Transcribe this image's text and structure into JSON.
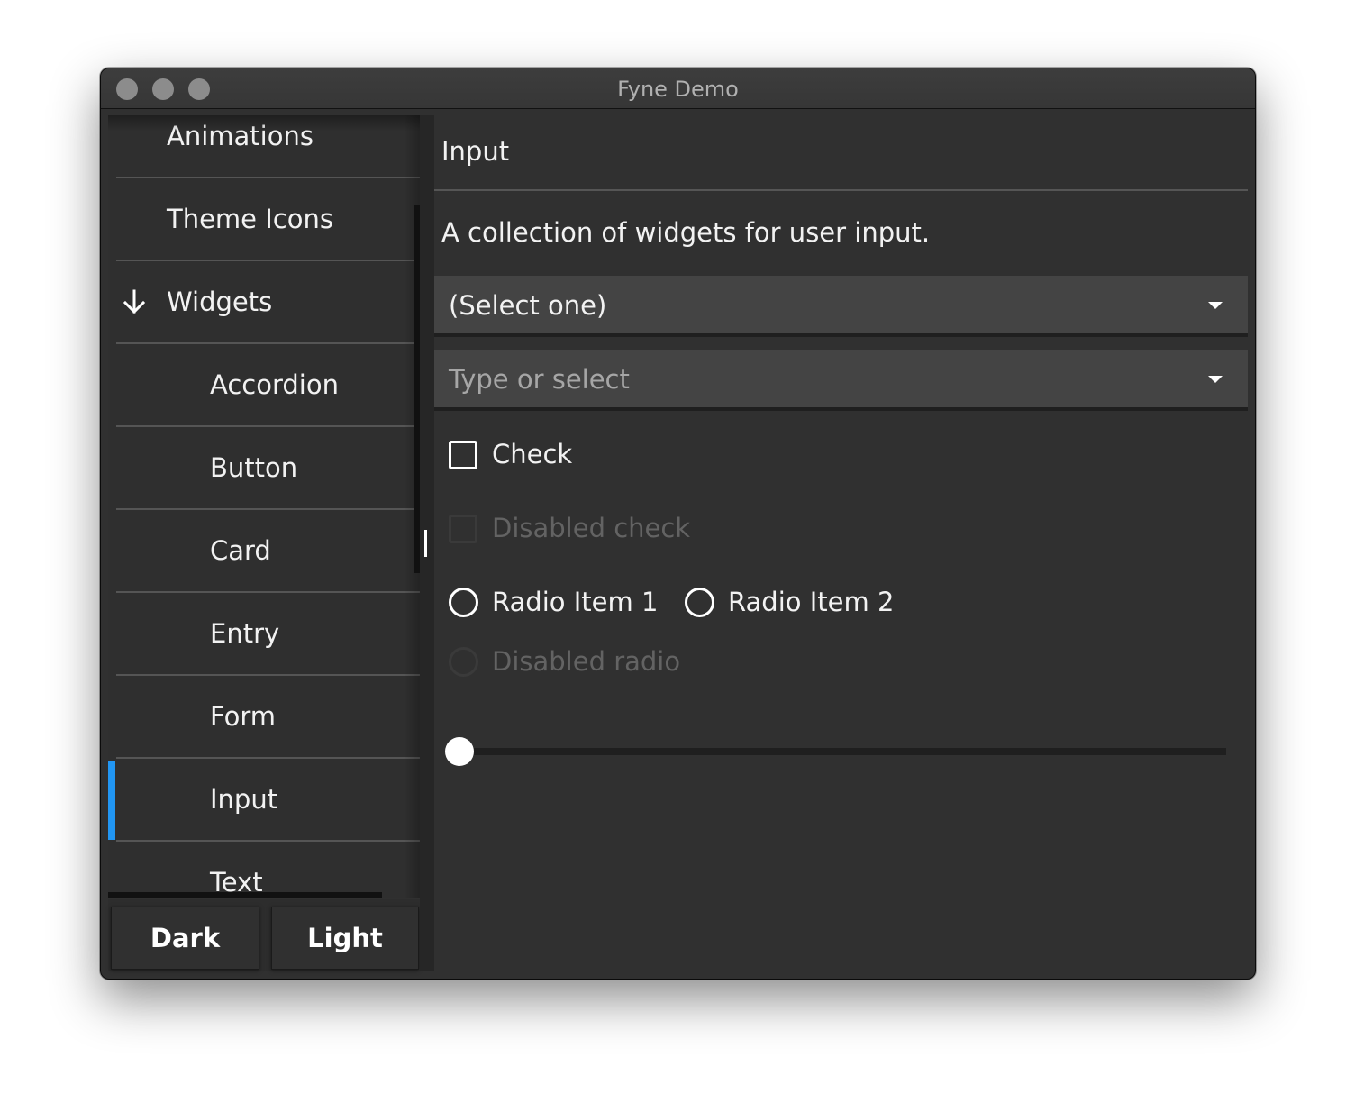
{
  "window": {
    "title": "Fyne Demo",
    "traffic_lights": [
      "close",
      "minimize",
      "zoom"
    ]
  },
  "sidebar": {
    "items": [
      {
        "label": "Animations",
        "level": 0,
        "selected": false
      },
      {
        "label": "Theme Icons",
        "level": 0,
        "selected": false
      },
      {
        "label": "Widgets",
        "level": 0,
        "expanded": true,
        "icon": "arrow-down-icon",
        "selected": false
      },
      {
        "label": "Accordion",
        "level": 1,
        "selected": false
      },
      {
        "label": "Button",
        "level": 1,
        "selected": false
      },
      {
        "label": "Card",
        "level": 1,
        "selected": false
      },
      {
        "label": "Entry",
        "level": 1,
        "selected": false
      },
      {
        "label": "Form",
        "level": 1,
        "selected": false
      },
      {
        "label": "Input",
        "level": 1,
        "selected": true
      },
      {
        "label": "Text",
        "level": 1,
        "selected": false
      }
    ],
    "selection_color": "#2196f3",
    "theme_buttons": {
      "dark": "Dark",
      "light": "Light"
    }
  },
  "content": {
    "title": "Input",
    "description": "A collection of widgets for user input.",
    "select": {
      "value": "(Select one)"
    },
    "select_entry": {
      "placeholder": "Type or select",
      "value": ""
    },
    "check": {
      "label": "Check",
      "checked": false
    },
    "disabled_check": {
      "label": "Disabled check",
      "checked": false
    },
    "radio": {
      "options": [
        "Radio Item 1",
        "Radio Item 2"
      ],
      "selected": null
    },
    "disabled_radio": {
      "label": "Disabled radio"
    },
    "slider": {
      "value": 0
    }
  }
}
